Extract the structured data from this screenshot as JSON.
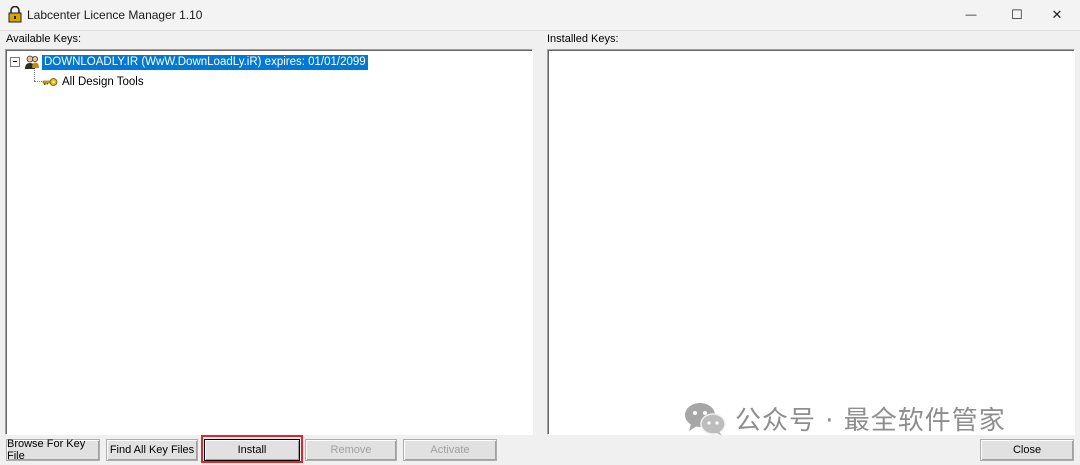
{
  "window": {
    "title": "Labcenter Licence Manager 1.10",
    "minimize_glyph": "—",
    "maximize_glyph": "☐",
    "close_glyph": "✕"
  },
  "available": {
    "label": "Available Keys:",
    "tree": {
      "root_label": "DOWNLOADLY.IR (WwW.DownLoadLy.iR) expires: 01/01/2099",
      "root_icon": "user-group-icon",
      "children": [
        {
          "label": "All Design Tools",
          "icon": "key-icon"
        }
      ]
    }
  },
  "installed": {
    "label": "Installed Keys:"
  },
  "buttons": {
    "browse": "Browse For Key File",
    "find_all": "Find All Key Files",
    "install": "Install",
    "remove": "Remove",
    "activate": "Activate",
    "close": "Close"
  },
  "watermark": {
    "text": "公众号 · 最全软件管家",
    "icon": "wechat-icon"
  },
  "colors": {
    "selection": "#0078d7",
    "highlight_box": "#e0262b"
  }
}
